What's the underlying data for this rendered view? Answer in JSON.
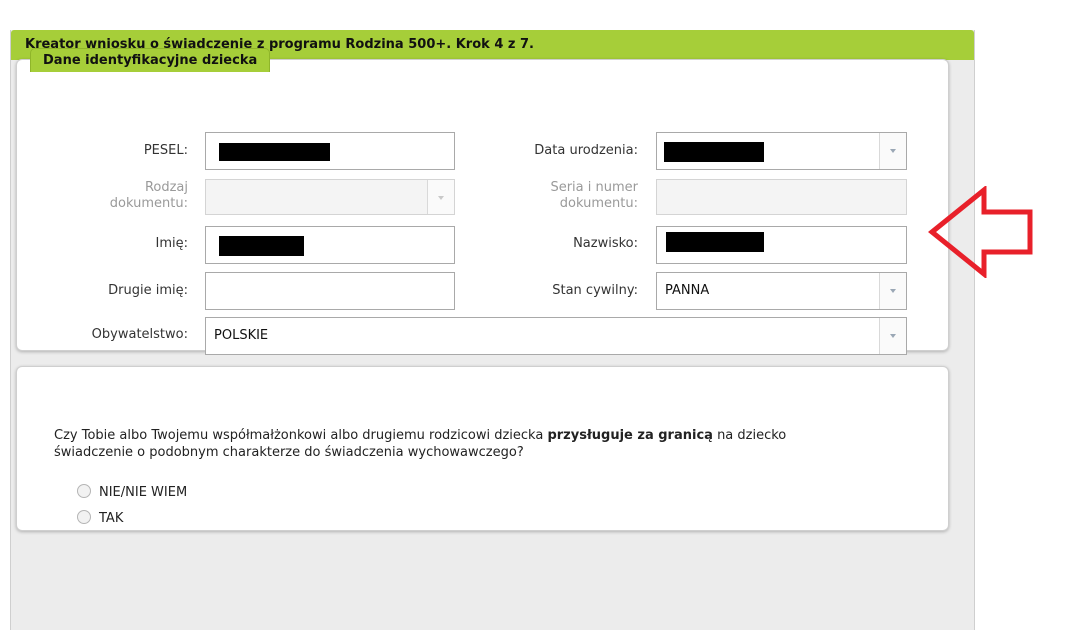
{
  "header": {
    "title": "Kreator wniosku o świadczenie z programu Rodzina 500+. Krok 4 z 7."
  },
  "child_section": {
    "title": "Dane identyfikacyjne dziecka",
    "pesel": {
      "label": "PESEL:",
      "value": "",
      "value_redacted": true
    },
    "birth_date": {
      "label": "Data urodzenia:",
      "value": "",
      "value_redacted": true
    },
    "document_type": {
      "label_line1": "Rodzaj",
      "label_line2": "dokumentu:",
      "value": "",
      "disabled": true
    },
    "document_number": {
      "label_line1": "Seria i numer",
      "label_line2": "dokumentu:",
      "value": "",
      "disabled": true
    },
    "first_name": {
      "label": "Imię:",
      "value": "",
      "value_redacted": true
    },
    "last_name": {
      "label": "Nazwisko:",
      "value": "",
      "value_redacted": true
    },
    "second_name": {
      "label": "Drugie imię:",
      "value": ""
    },
    "marital_status": {
      "label": "Stan cywilny:",
      "value": "PANNA"
    },
    "citizenship": {
      "label": "Obywatelstwo:",
      "value": "POLSKIE"
    }
  },
  "question": {
    "text_before": "Czy Tobie albo Twojemu współmałżonkowi albo drugiemu rodzicowi dziecka ",
    "text_bold": "przysługuje za granicą",
    "text_after_line1": " na dziecko",
    "text_line2": "świadczenie o podobnym charakterze do świadczenia wychowawczego?",
    "options": [
      {
        "label": "NIE/NIE WIEM",
        "selected": false
      },
      {
        "label": "TAK",
        "selected": false
      }
    ]
  },
  "colors": {
    "accent_green": "#a6ce39",
    "annotation_arrow": "#e8202a"
  },
  "annotation": {
    "icon": "red-arrow-pointing-left"
  }
}
